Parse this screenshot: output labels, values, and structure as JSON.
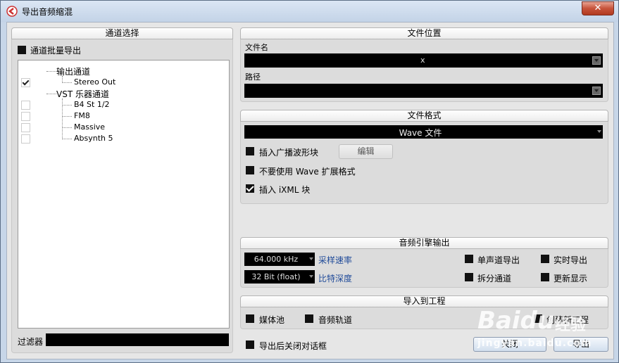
{
  "window": {
    "title": "导出音频缩混",
    "close_label": "✕"
  },
  "channel_selection": {
    "header": "通道选择",
    "batch_export_label": "通道批量导出",
    "tree": {
      "output_group": "输出通道",
      "stereo_out": "Stereo Out",
      "vst_group": "VST 乐器通道",
      "items": [
        "B4 St 1/2",
        "FM8",
        "Massive",
        "Absynth 5"
      ]
    },
    "filter_label": "过滤器",
    "filter_value": ""
  },
  "file_location": {
    "header": "文件位置",
    "filename_label": "文件名",
    "filename_value": "x",
    "path_label": "路径",
    "path_value": ""
  },
  "file_format": {
    "header": "文件格式",
    "format_value": "Wave 文件",
    "insert_broadcast_label": "插入广播波形块",
    "edit_label": "编辑",
    "no_wave_ext_label": "不要使用 Wave 扩展格式",
    "insert_ixml_label": "插入 iXML 块"
  },
  "audio_engine": {
    "header": "音频引擎输出",
    "sample_rate_value": "64.000 kHz",
    "sample_rate_label": "采样速率",
    "bit_depth_value": "32 Bit (float)",
    "bit_depth_label": "比特深度",
    "mono_export_label": "单声道导出",
    "realtime_export_label": "实时导出",
    "split_channels_label": "拆分通道",
    "update_display_label": "更新显示"
  },
  "import_project": {
    "header": "导入到工程",
    "pool_label": "媒体池",
    "audio_track_label": "音频轨道",
    "new_project_label": "创建新工程"
  },
  "footer": {
    "close_after_label": "导出后关闭对话框",
    "close_button": "关闭",
    "export_button": "导出"
  },
  "watermark": {
    "brand": "Baidu",
    "sub": "经验",
    "url": "jingyan.baidu.com"
  },
  "colors": {
    "accent": "#1f4a99",
    "field_bg": "#000000",
    "panel_bg": "#dcdcdc"
  }
}
